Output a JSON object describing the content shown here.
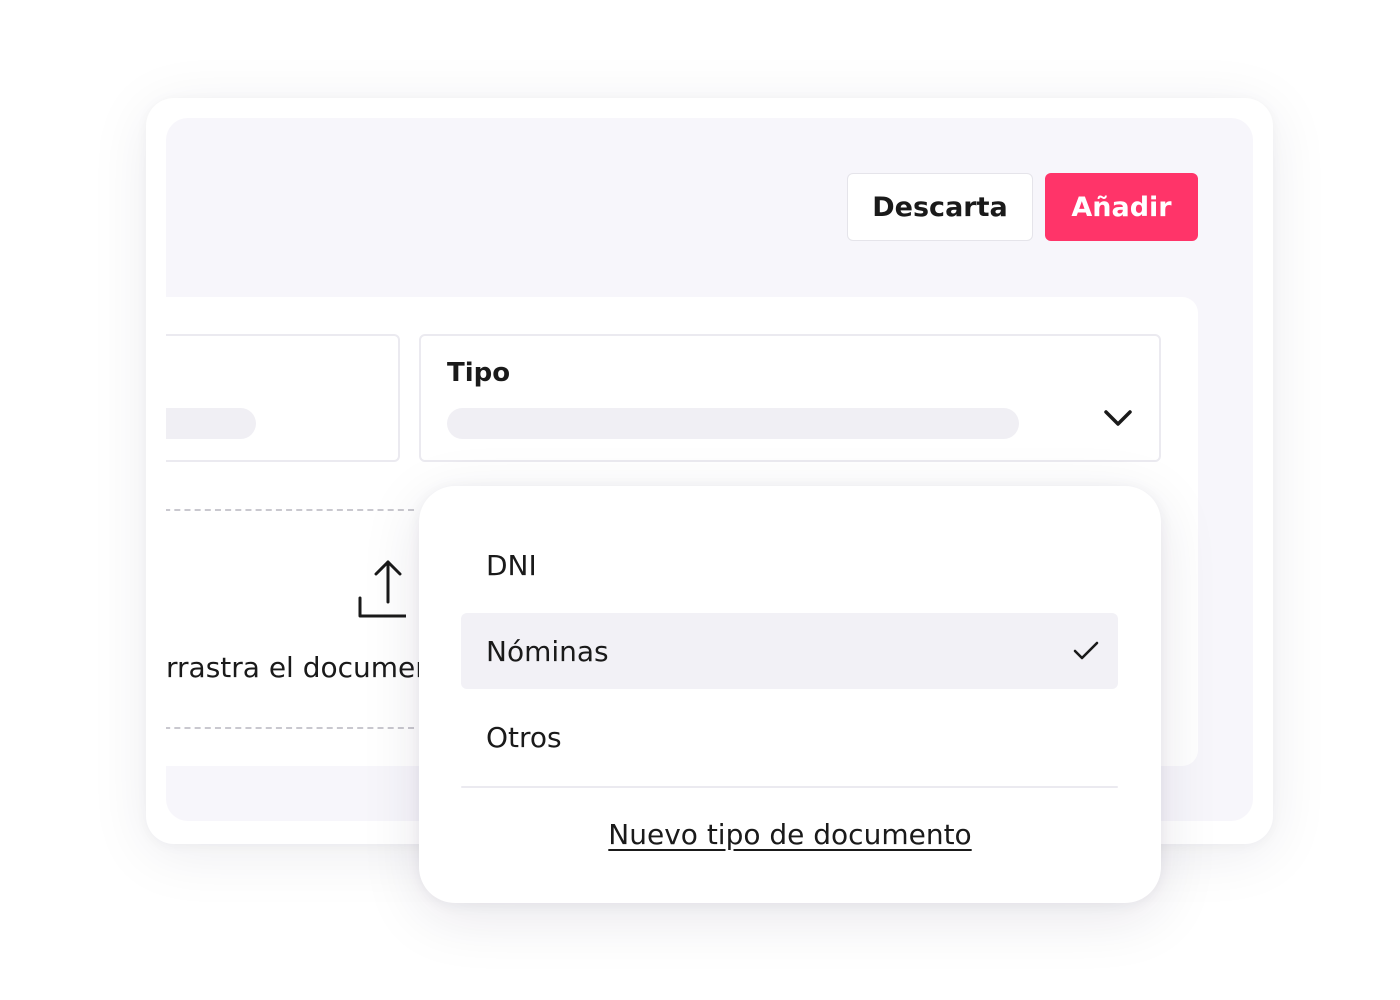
{
  "header": {
    "discard_label": "Descarta",
    "add_label": "Añadir"
  },
  "form": {
    "tipo_label": "Tipo",
    "drag_text": "rrastra el documento"
  },
  "dropdown": {
    "options": [
      {
        "label": "DNI",
        "selected": false
      },
      {
        "label": "Nóminas",
        "selected": true
      },
      {
        "label": "Otros",
        "selected": false
      }
    ],
    "new_type_link": "Nuevo tipo de documento"
  },
  "colors": {
    "accent": "#ff3469",
    "panel_bg": "#f7f6fb",
    "selected_bg": "#f2f1f6"
  },
  "icons": [
    "chevron-down-icon",
    "upload-icon",
    "check-icon"
  ]
}
